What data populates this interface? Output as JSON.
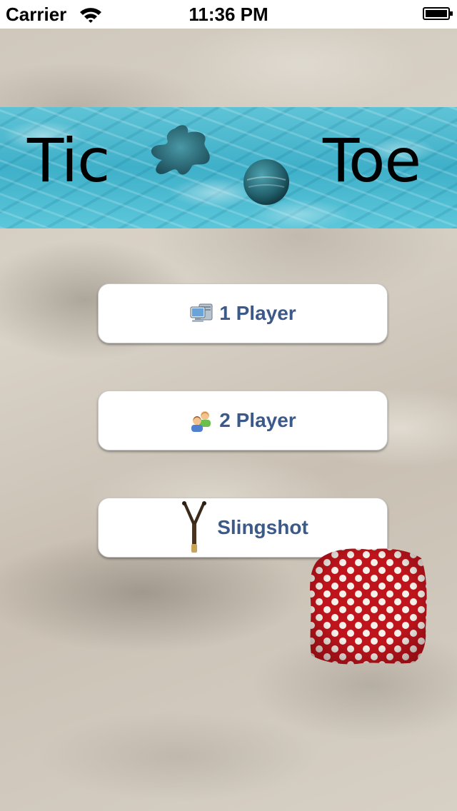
{
  "status_bar": {
    "carrier": "Carrier",
    "time": "11:36 PM",
    "wifi_icon": "wifi-icon",
    "battery_icon": "battery-icon"
  },
  "title": {
    "left_word": "Tic",
    "right_word": "Toe",
    "x_mark_icon": "splat-x-icon",
    "o_mark_icon": "ball-o-icon"
  },
  "menu": {
    "one_player": {
      "label": "1 Player",
      "icon": "computer-icon"
    },
    "two_player": {
      "label": "2 Player",
      "icon": "users-icon"
    },
    "slingshot": {
      "label": "Slingshot",
      "icon": "slingshot-icon"
    }
  },
  "decor": {
    "beanbag_icon": "polka-dot-beanbag-icon"
  },
  "colors": {
    "button_text": "#3b5a8a",
    "water": "#3fb0c9",
    "beanbag_red": "#c0141c"
  }
}
